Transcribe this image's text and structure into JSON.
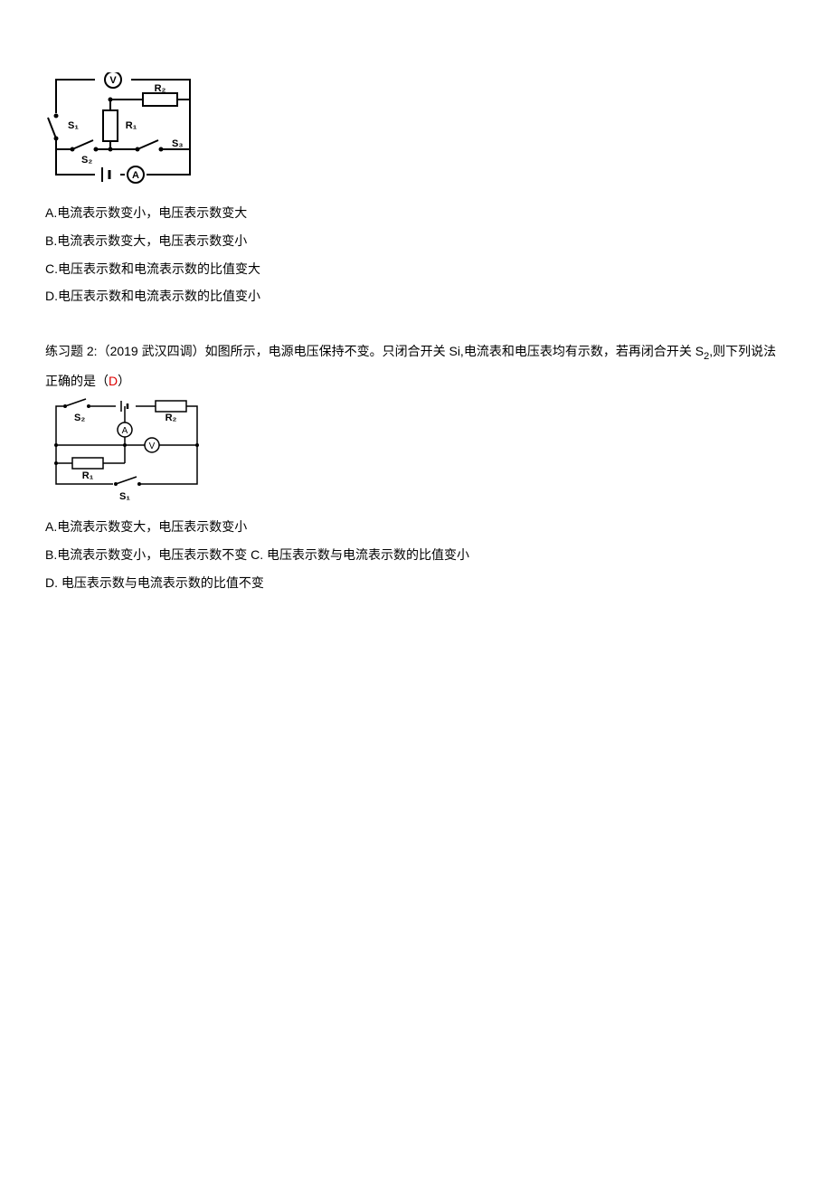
{
  "q1": {
    "options": {
      "a": "A.电流表示数变小，电压表示数变大",
      "b": "B.电流表示数变大，电压表示数变小",
      "c": "C.电压表示数和电流表示数的比值变大",
      "d": "D.电压表示数和电流表示数的比值变小"
    },
    "circuit": {
      "v": "V",
      "a": "A",
      "r1": "R₁",
      "r2": "R₂",
      "s1": "S₁",
      "s2": "S₂",
      "s3": "S₃"
    }
  },
  "q2": {
    "stem_part1": "练习题 2:（2019 武汉四调）如图所示，电源电压保持不变。只闭合开关 Si,电流表和电压表均有示数，若再闭合开关 S",
    "stem_sub": "2",
    "stem_part2": ",则下列说法正确的是（",
    "answer": "D",
    "stem_part3": "）",
    "options": {
      "a": "A.电流表示数变大，电压表示数变小",
      "bc": "B.电流表示数变小，电压表示数不变 C. 电压表示数与电流表示数的比值变小",
      "d": "D. 电压表示数与电流表示数的比值不变"
    },
    "circuit": {
      "v": "V",
      "a": "A",
      "r1": "R₁",
      "r2": "R₂",
      "s1": "S₁",
      "s2": "S₂"
    }
  }
}
